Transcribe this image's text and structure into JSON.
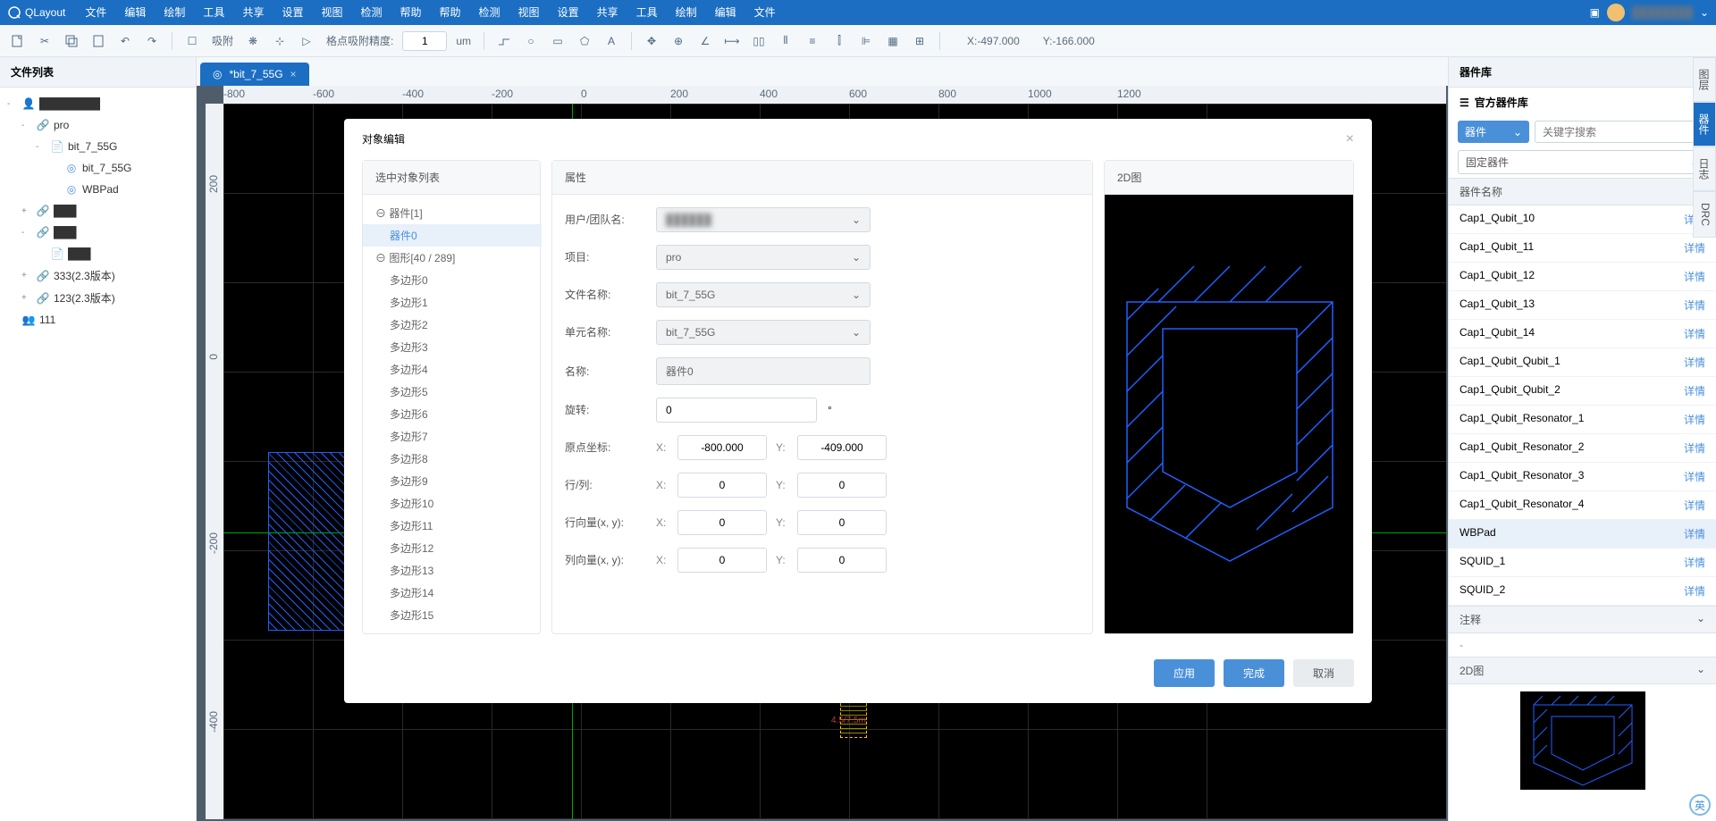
{
  "app_name": "QLayout",
  "menu": [
    "文件",
    "编辑",
    "绘制",
    "工具",
    "共享",
    "设置",
    "视图",
    "检测",
    "帮助"
  ],
  "user_name": "████████",
  "toolbar": {
    "snap_label": "吸附",
    "precision_label": "格点吸附精度:",
    "precision_value": "1",
    "precision_unit": "um",
    "coord_x": "X:-497.000",
    "coord_y": "Y:-166.000"
  },
  "left": {
    "title": "文件列表",
    "items": [
      {
        "lvl": 0,
        "expand": "-",
        "ico": "user",
        "label": "████████"
      },
      {
        "lvl": 1,
        "expand": "-",
        "ico": "share",
        "label": "pro"
      },
      {
        "lvl": 2,
        "expand": "-",
        "ico": "file",
        "label": "bit_7_55G"
      },
      {
        "lvl": 3,
        "expand": "",
        "ico": "comp",
        "label": "bit_7_55G"
      },
      {
        "lvl": 3,
        "expand": "",
        "ico": "comp",
        "label": "WBPad"
      },
      {
        "lvl": 1,
        "expand": "+",
        "ico": "share",
        "label": "███"
      },
      {
        "lvl": 1,
        "expand": "-",
        "ico": "share",
        "label": "███"
      },
      {
        "lvl": 2,
        "expand": "",
        "ico": "file",
        "label": "███"
      },
      {
        "lvl": 1,
        "expand": "+",
        "ico": "share",
        "label": "333(2.3版本)"
      },
      {
        "lvl": 1,
        "expand": "+",
        "ico": "share",
        "label": "123(2.3版本)"
      },
      {
        "lvl": 0,
        "expand": "",
        "ico": "group",
        "label": "111"
      }
    ]
  },
  "tab": {
    "label": "*bit_7_55G"
  },
  "ruler_h": [
    "-800",
    "-600",
    "-400",
    "-200",
    "0",
    "200",
    "400",
    "600",
    "800",
    "1000",
    "1200"
  ],
  "ruler_v": [
    "200",
    "0",
    "-200",
    "-400"
  ],
  "canvas": {
    "dim_label": "4.5/7.5m"
  },
  "modal": {
    "title": "对象编辑",
    "list_header": "选中对象列表",
    "groups": [
      {
        "label": "器件[1]",
        "items": [
          "器件0"
        ],
        "active": 0
      },
      {
        "label": "图形[40 / 289]",
        "items": [
          "多边形0",
          "多边形1",
          "多边形2",
          "多边形3",
          "多边形4",
          "多边形5",
          "多边形6",
          "多边形7",
          "多边形8",
          "多边形9",
          "多边形10",
          "多边形11",
          "多边形12",
          "多边形13",
          "多边形14",
          "多边形15"
        ]
      }
    ],
    "props_header": "属性",
    "props": {
      "user_team_label": "用户/团队名:",
      "user_team_value": "██████",
      "project_label": "项目:",
      "project_value": "pro",
      "file_label": "文件名称:",
      "file_value": "bit_7_55G",
      "unit_label": "单元名称:",
      "unit_value": "bit_7_55G",
      "name_label": "名称:",
      "name_value": "器件0",
      "rotate_label": "旋转:",
      "rotate_value": "0",
      "rotate_unit": "°",
      "origin_label": "原点坐标:",
      "origin_x": "-800.000",
      "origin_y": "-409.000",
      "rowcol_label": "行/列:",
      "rowcol_x": "0",
      "rowcol_y": "0",
      "rowvec_label": "行向量(x, y):",
      "rowvec_x": "0",
      "rowvec_y": "0",
      "colvec_label": "列向量(x, y):",
      "colvec_x": "0",
      "colvec_y": "0",
      "x_label": "X:",
      "y_label": "Y:"
    },
    "preview_header": "2D图",
    "btn_apply": "应用",
    "btn_ok": "完成",
    "btn_cancel": "取消"
  },
  "right": {
    "title": "器件库",
    "official": "官方器件库",
    "type_dd": "器件",
    "search_placeholder": "关键字搜索",
    "fixed_dd": "固定器件",
    "section": "器件名称",
    "items": [
      "Cap1_Qubit_10",
      "Cap1_Qubit_11",
      "Cap1_Qubit_12",
      "Cap1_Qubit_13",
      "Cap1_Qubit_14",
      "Cap1_Qubit_Qubit_1",
      "Cap1_Qubit_Qubit_2",
      "Cap1_Qubit_Resonator_1",
      "Cap1_Qubit_Resonator_2",
      "Cap1_Qubit_Resonator_3",
      "Cap1_Qubit_Resonator_4",
      "WBPad",
      "SQUID_1",
      "SQUID_2"
    ],
    "active_item": "WBPad",
    "detail": "详情",
    "note_section": "注释",
    "note_value": "-",
    "preview_section": "2D图"
  },
  "right_tabs": [
    "图层",
    "器件",
    "日志",
    "DRC"
  ],
  "right_tab_active": 1,
  "ime": "英"
}
